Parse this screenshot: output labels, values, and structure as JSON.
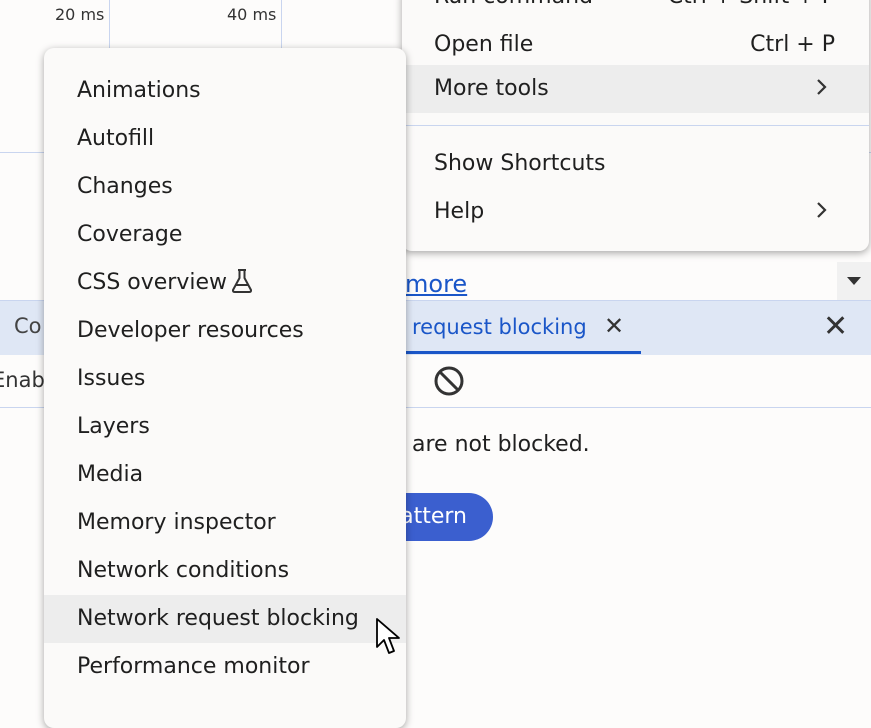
{
  "timeline": {
    "ticks": [
      "20 ms",
      "40 ms"
    ]
  },
  "background": {
    "learn_more_fragment": "more",
    "tab_left_fragment": "Co",
    "tab_active_label": "request blocking",
    "tab_close_symbol": "✕",
    "panel_close_symbol": "✕",
    "enable_fragment": "Enab",
    "status_text": "are not blocked.",
    "add_button_fragment": "attern"
  },
  "main_menu": {
    "items": [
      {
        "label": "Run command",
        "shortcut": "Ctrl + Shift + P"
      },
      {
        "label": "Open file",
        "shortcut": "Ctrl + P"
      },
      {
        "label": "More tools",
        "submenu": true
      },
      {
        "label": "Show Shortcuts"
      },
      {
        "label": "Help",
        "submenu": true
      }
    ]
  },
  "more_tools_menu": {
    "items": [
      {
        "label": "Animations"
      },
      {
        "label": "Autofill"
      },
      {
        "label": "Changes"
      },
      {
        "label": "Coverage"
      },
      {
        "label": "CSS overview",
        "icon": "flask-icon"
      },
      {
        "label": "Developer resources"
      },
      {
        "label": "Issues"
      },
      {
        "label": "Layers"
      },
      {
        "label": "Media"
      },
      {
        "label": "Memory inspector"
      },
      {
        "label": "Network conditions"
      },
      {
        "label": "Network request blocking",
        "hovered": true
      },
      {
        "label": "Performance monitor"
      }
    ]
  },
  "colors": {
    "accent": "#1a56c8",
    "button": "#3b5fcf",
    "hover": "#ededed",
    "tabbar": "#dfe7f5"
  }
}
